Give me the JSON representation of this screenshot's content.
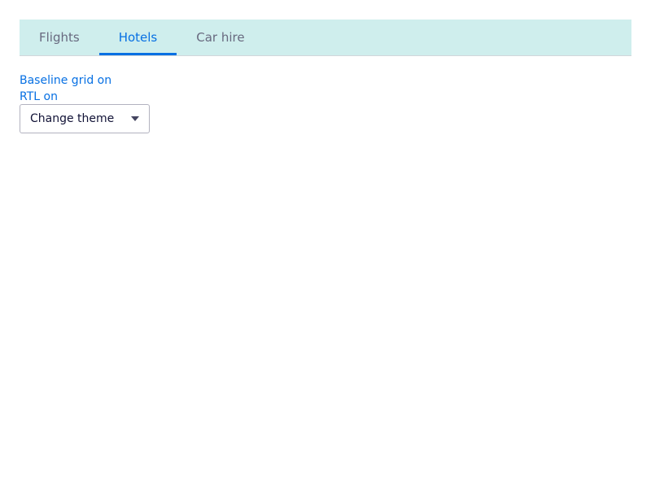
{
  "tabs": [
    {
      "label": "Flights",
      "active": false
    },
    {
      "label": "Hotels",
      "active": true
    },
    {
      "label": "Car hire",
      "active": false
    }
  ],
  "links": {
    "baseline_grid": "Baseline grid on",
    "rtl": "RTL on"
  },
  "theme_select": {
    "label": "Change theme",
    "icon": "chevron-down-icon"
  },
  "colors": {
    "tabbar_background": "#cfeeed",
    "accent": "#0770e3",
    "tab_text": "#68697f"
  }
}
